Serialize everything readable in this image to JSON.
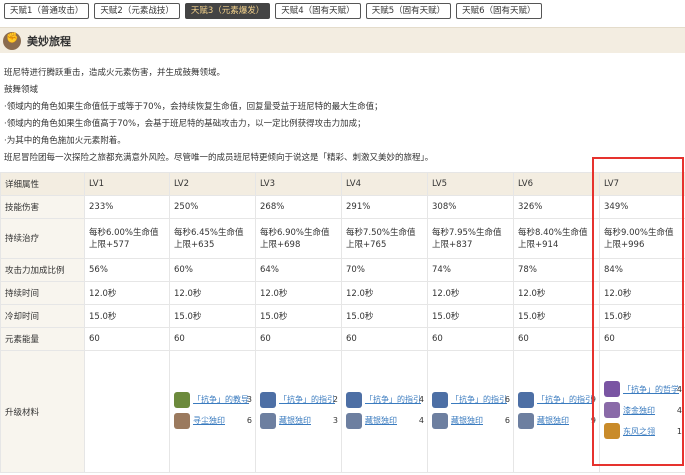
{
  "tabs": [
    {
      "label": "天赋1（普通攻击）",
      "active": false
    },
    {
      "label": "天赋2（元素战技）",
      "active": false
    },
    {
      "label": "天赋3（元素爆发）",
      "active": true
    },
    {
      "label": "天赋4（固有天赋）",
      "active": false
    },
    {
      "label": "天赋5（固有天赋）",
      "active": false
    },
    {
      "label": "天赋6（固有天赋）",
      "active": false
    }
  ],
  "section": {
    "title": "美妙旅程",
    "icon": "fist-icon"
  },
  "description": {
    "line1": "班尼特进行腾跃重击，造成火元素伤害，并生成鼓舞领域。",
    "line2": "鼓舞领域",
    "line3": "·领域内的角色如果生命值低于或等于70%，会持续恢复生命值，回复量受益于班尼特的最大生命值；",
    "line4": "·领域内的角色如果生命值高于70%，会基于班尼特的基础攻击力，以一定比例获得攻击力加成；",
    "line5": "·为其中的角色施加火元素附着。",
    "line6": "班尼冒险团每一次探险之旅都充满意外风险。尽管唯一的成员班尼特更倾向于说这是「精彩、刺激又美妙的旅程」。"
  },
  "table": {
    "headers": [
      "详细属性",
      "LV1",
      "LV2",
      "LV3",
      "LV4",
      "LV5",
      "LV6",
      "LV7"
    ],
    "rows": [
      {
        "label": "技能伤害",
        "cells": [
          "233%",
          "250%",
          "268%",
          "291%",
          "308%",
          "326%",
          "349%"
        ]
      },
      {
        "label": "持续治疗",
        "cells": [
          {
            "a": "每秒6.00%生命值",
            "b": "上限+577"
          },
          {
            "a": "每秒6.45%生命值",
            "b": "上限+635"
          },
          {
            "a": "每秒6.90%生命值",
            "b": "上限+698"
          },
          {
            "a": "每秒7.50%生命值",
            "b": "上限+765"
          },
          {
            "a": "每秒7.95%生命值",
            "b": "上限+837"
          },
          {
            "a": "每秒8.40%生命值",
            "b": "上限+914"
          },
          {
            "a": "每秒9.00%生命值",
            "b": "上限+996"
          }
        ]
      },
      {
        "label": "攻击力加成比例",
        "cells": [
          "56%",
          "60%",
          "64%",
          "70%",
          "74%",
          "78%",
          "84%"
        ]
      },
      {
        "label": "持续时间",
        "cells": [
          "12.0秒",
          "12.0秒",
          "12.0秒",
          "12.0秒",
          "12.0秒",
          "12.0秒",
          "12.0秒"
        ]
      },
      {
        "label": "冷却时间",
        "cells": [
          "15.0秒",
          "15.0秒",
          "15.0秒",
          "15.0秒",
          "15.0秒",
          "15.0秒",
          "15.0秒"
        ]
      },
      {
        "label": "元素能量",
        "cells": [
          "60",
          "60",
          "60",
          "60",
          "60",
          "60",
          "60"
        ]
      }
    ],
    "materials_label": "升级材料",
    "materials": [
      [],
      [
        {
          "name": "「抗争」的教导",
          "count": "3",
          "icon": "book-icon",
          "color": "#6c8a3c"
        },
        {
          "name": "寻尘独印",
          "count": "6",
          "icon": "mask-icon",
          "color": "#9b7a5e"
        }
      ],
      [
        {
          "name": "「抗争」的指引",
          "count": "2",
          "icon": "book-icon",
          "color": "#4d6fa5"
        },
        {
          "name": "藏银独印",
          "count": "3",
          "icon": "mask-icon",
          "color": "#6d7fa0"
        }
      ],
      [
        {
          "name": "「抗争」的指引",
          "count": "4",
          "icon": "book-icon",
          "color": "#4d6fa5"
        },
        {
          "name": "藏银独印",
          "count": "4",
          "icon": "mask-icon",
          "color": "#6d7fa0"
        }
      ],
      [
        {
          "name": "「抗争」的指引",
          "count": "6",
          "icon": "book-icon",
          "color": "#4d6fa5"
        },
        {
          "name": "藏银独印",
          "count": "6",
          "icon": "mask-icon",
          "color": "#6d7fa0"
        }
      ],
      [
        {
          "name": "「抗争」的指引",
          "count": "9",
          "icon": "book-icon",
          "color": "#4d6fa5"
        },
        {
          "name": "藏银独印",
          "count": "9",
          "icon": "mask-icon",
          "color": "#6d7fa0"
        }
      ],
      [
        {
          "name": "「抗争」的哲学",
          "count": "4",
          "icon": "book-icon",
          "color": "#7a55a3"
        },
        {
          "name": "漆金独印",
          "count": "4",
          "icon": "mask-icon",
          "color": "#8a6aa8"
        },
        {
          "name": "东风之翎",
          "count": "1",
          "icon": "feather-icon",
          "color": "#c98b2a"
        }
      ]
    ]
  },
  "highlight_color": "#e6322e"
}
